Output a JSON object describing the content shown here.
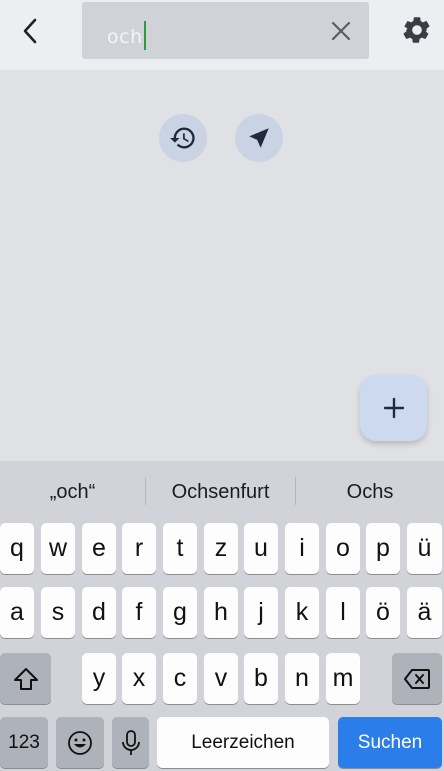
{
  "search": {
    "value": "och"
  },
  "icons": {
    "back": "chevron-left-icon",
    "clear": "close-icon",
    "settings": "gear-icon",
    "history": "history-icon",
    "location": "navigation-arrow-icon",
    "add": "plus-icon"
  },
  "fab": {
    "label": "+"
  },
  "keyboard": {
    "suggestions": [
      "„och“",
      "Ochsenfurt",
      "Ochs"
    ],
    "row1": [
      "q",
      "w",
      "e",
      "r",
      "t",
      "z",
      "u",
      "i",
      "o",
      "p",
      "ü"
    ],
    "row2": [
      "a",
      "s",
      "d",
      "f",
      "g",
      "h",
      "j",
      "k",
      "l",
      "ö",
      "ä"
    ],
    "row3": [
      "y",
      "x",
      "c",
      "v",
      "b",
      "n",
      "m"
    ],
    "numbers_label": "123",
    "space_label": "Leerzeichen",
    "return_label": "Suchen"
  },
  "colors": {
    "accent": "#2b7de9",
    "caret": "#2e9b3f",
    "fab_background": "#cdd9ef"
  }
}
